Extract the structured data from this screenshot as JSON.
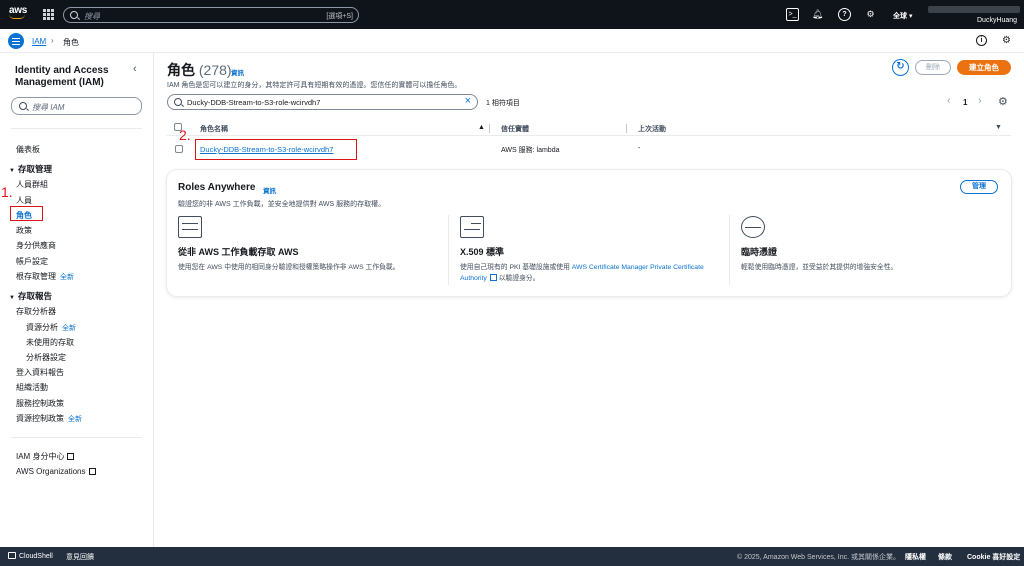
{
  "topnav": {
    "logo": "aws",
    "search_placeholder": "搜尋",
    "search_shortcut": "[選項+S]",
    "region": "全球 ▾",
    "username": "DuckyHuang",
    "icons": [
      "cloudshell-icon",
      "bell-icon",
      "help-icon",
      "gear-icon"
    ]
  },
  "breadcrumb": {
    "root": "IAM",
    "separator": "›",
    "current": "角色"
  },
  "sidebar": {
    "title": "Identity and Access Management (IAM)",
    "search_placeholder": "搜尋 IAM",
    "dashboard": "儀表板",
    "access_management": {
      "heading": "存取管理",
      "items": [
        "人員群組",
        "人員",
        "角色",
        "政策",
        "身分供應商",
        "帳戶設定",
        "根存取管理"
      ],
      "new_badge": "全新"
    },
    "access_reports": {
      "heading": "存取報告",
      "analyzer": "存取分析器",
      "sub_items": [
        "資源分析",
        "未使用的存取",
        "分析器設定"
      ],
      "new_badge": "全新",
      "items": [
        "登入資料報告",
        "組織活動",
        "服務控制政策",
        "資源控制政策"
      ],
      "rcp_new": "全新"
    },
    "links": [
      "IAM 身分中心",
      "AWS Organizations"
    ]
  },
  "annotations": {
    "one": "1.",
    "two": "2."
  },
  "main": {
    "title": "角色",
    "count": "(278)",
    "info": "資訊",
    "description": "IAM 角色是您可以建立的身分，其特定許可具有短期有效的憑證。您信任的實體可以擔任角色。",
    "refresh_label": "↻",
    "delete_label": "刪除",
    "create_label": "建立角色",
    "filter_value": "Ducky-DDB-Stream-to-S3-role-wcirvdh7",
    "match_count": "1 相符項目",
    "page": "1",
    "columns": [
      "角色名稱",
      "信任實體",
      "上次活動"
    ],
    "rows": [
      {
        "name": "Ducky-DDB-Stream-to-S3-role-wcirvdh7",
        "trusted": "AWS 服務: lambda",
        "last_activity": "-"
      }
    ]
  },
  "roles_anywhere": {
    "title": "Roles Anywhere",
    "info": "資訊",
    "description": "驗證您的非 AWS 工作負載，並安全地提供對 AWS 服務的存取權。",
    "manage": "管理",
    "features": [
      {
        "icon": "server-icon",
        "heading": "從非 AWS 工作負載存取 AWS",
        "text": "使用您在 AWS 中使用的相同身分驗證和授權策略操作非 AWS 工作負載。"
      },
      {
        "icon": "certificate-icon",
        "heading": "X.509 標準",
        "text_before": "使用自己現有的 PKI 基礎設施或使用 ",
        "link": "AWS Certificate Manager Private Certificate Authority",
        "text_after": " 以驗證身分。"
      },
      {
        "icon": "key-icon",
        "heading": "臨時憑證",
        "text": "輕鬆使用臨時憑證，並受益於其提供的增強安全性。"
      }
    ]
  },
  "footer": {
    "cloudshell": "CloudShell",
    "feedback": "意見回饋",
    "copyright": "© 2025, Amazon Web Services, Inc. 或其關係企業。",
    "privacy": "隱私權",
    "terms": "條款",
    "cookie": "Cookie 喜好設定"
  }
}
